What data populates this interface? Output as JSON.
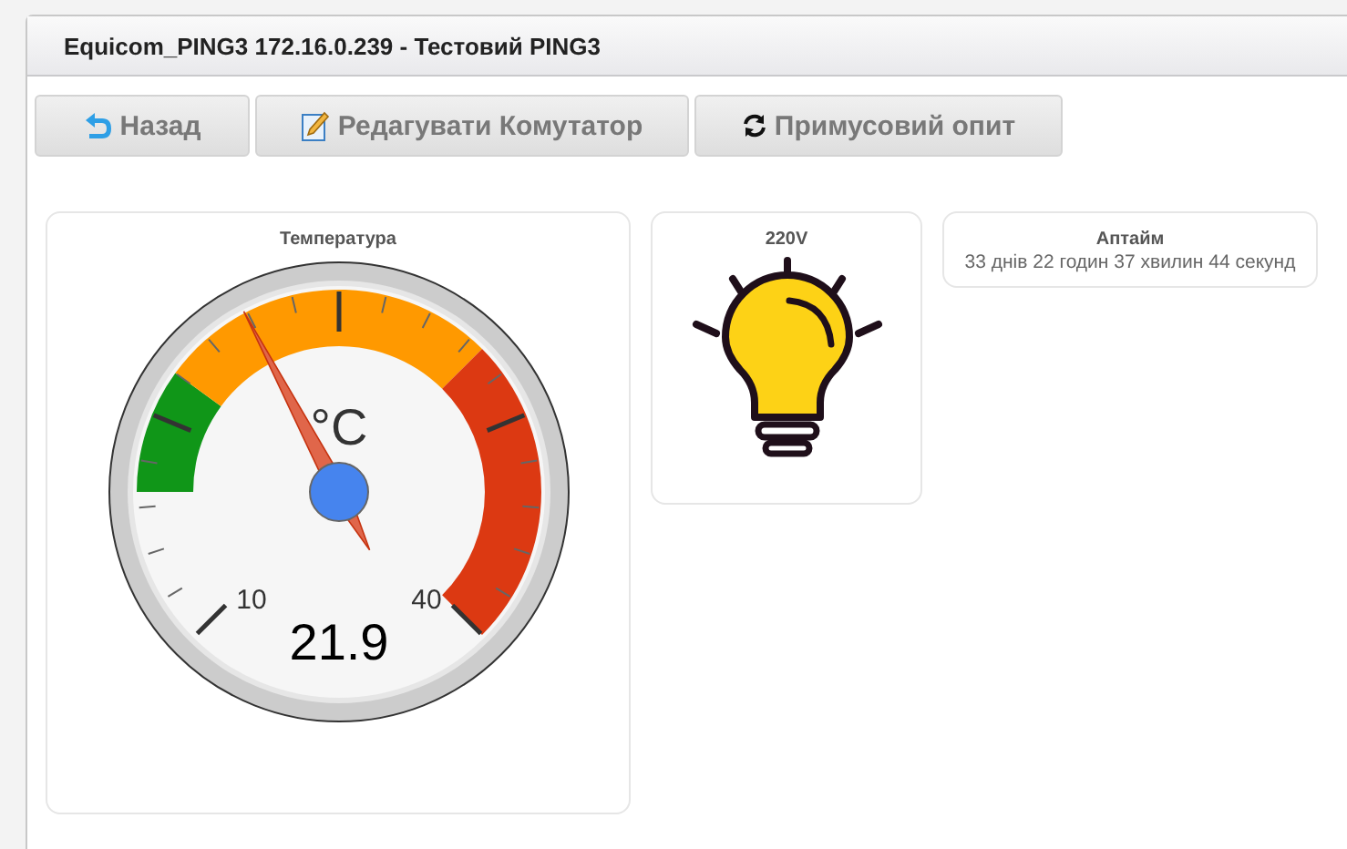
{
  "window": {
    "title": "Equicom_PING3 172.16.0.239 - Тестовий PING3"
  },
  "buttons": [
    {
      "kind": "back",
      "label": "Назад"
    },
    {
      "kind": "edit",
      "label": "Редагувати Комутатор"
    },
    {
      "kind": "refresh",
      "label": "Примусовий опит"
    }
  ],
  "gauge": {
    "title": "Температура",
    "unit": "°C",
    "min_label": "10",
    "max_label": "40",
    "value": "21.9",
    "level": 0.397
  },
  "lamp": {
    "title": "220V",
    "on": true
  },
  "uptime": {
    "title": "Аптайм",
    "value": "33 днів 22 годин 37 хвилин 44 секунд"
  }
}
